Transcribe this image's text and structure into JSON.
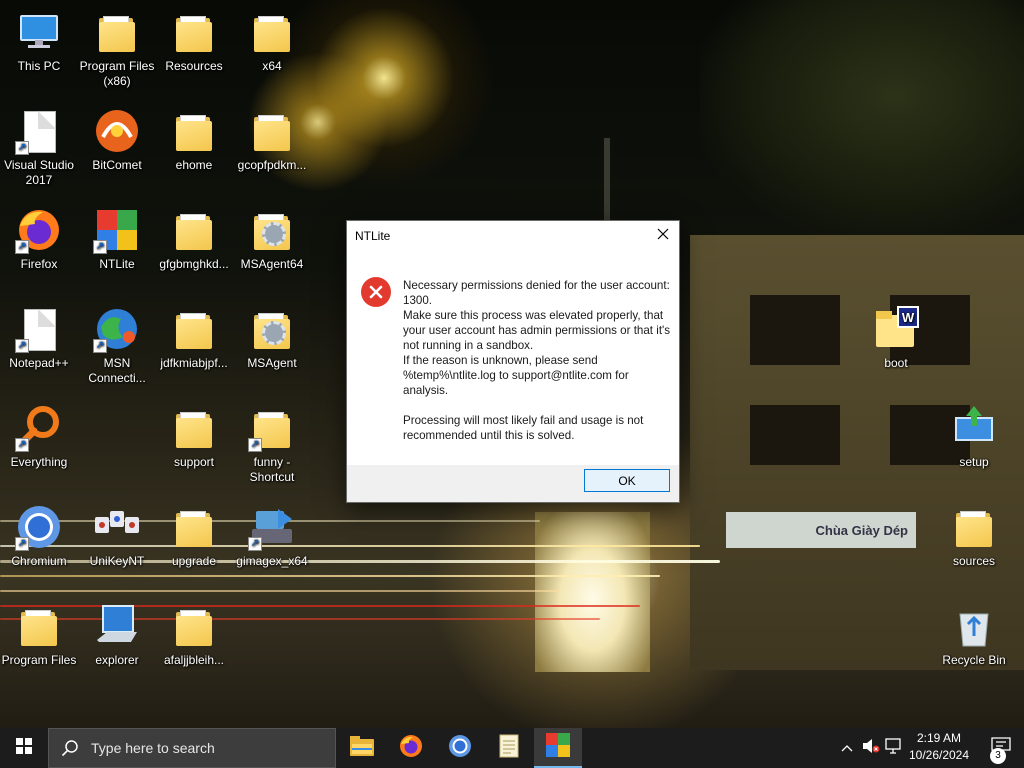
{
  "desktop": {
    "icons": [
      {
        "label": "This PC",
        "kind": "pc"
      },
      {
        "label": "Program Files (x86)",
        "kind": "folder"
      },
      {
        "label": "Resources",
        "kind": "folder"
      },
      {
        "label": "x64",
        "kind": "folder"
      },
      {
        "label": "Visual Studio 2017",
        "kind": "doc-shortcut"
      },
      {
        "label": "BitComet",
        "kind": "bitcomet"
      },
      {
        "label": "ehome",
        "kind": "folder"
      },
      {
        "label": "gcopfpdkm...",
        "kind": "folder"
      },
      {
        "label": "Firefox",
        "kind": "firefox"
      },
      {
        "label": "NTLite",
        "kind": "ntlite"
      },
      {
        "label": "gfgbmghkd...",
        "kind": "folder"
      },
      {
        "label": "MSAgent64",
        "kind": "folder-gear"
      },
      {
        "label": "Notepad++",
        "kind": "doc-shortcut"
      },
      {
        "label": "MSN Connecti...",
        "kind": "msn"
      },
      {
        "label": "jdfkmiabjpf...",
        "kind": "folder"
      },
      {
        "label": "MSAgent",
        "kind": "folder-gear"
      },
      {
        "label": "Everything",
        "kind": "everything"
      },
      {
        "label": "support",
        "kind": "folder"
      },
      {
        "label": "funny - Shortcut",
        "kind": "folder-shortcut"
      },
      {
        "label": "Chromium",
        "kind": "chromium"
      },
      {
        "label": "UniKeyNT",
        "kind": "unikey"
      },
      {
        "label": "upgrade",
        "kind": "folder"
      },
      {
        "label": "gimagex_x64",
        "kind": "gimagex"
      },
      {
        "label": "Program Files",
        "kind": "folder"
      },
      {
        "label": "explorer",
        "kind": "explorer"
      },
      {
        "label": "afaljjbleih...",
        "kind": "folder"
      },
      {
        "label": "boot",
        "kind": "boot"
      },
      {
        "label": "setup",
        "kind": "setup"
      },
      {
        "label": "sources",
        "kind": "folder"
      },
      {
        "label": "Recycle Bin",
        "kind": "recycle"
      }
    ]
  },
  "scene": {
    "shop_sign": "Chùa Giày Dép"
  },
  "dialog": {
    "title": "NTLite",
    "close_glyph": "✕",
    "error_glyph": "✕",
    "lines": [
      "Necessary permissions denied for the user account: 1300.",
      "Make sure this process was elevated properly, that your user account has admin permissions or that it's not running in a sandbox.",
      "If the reason is unknown, please send %temp%\\ntlite.log to support@ntlite.com for analysis."
    ],
    "note": "Processing will most likely fail and usage is not recommended until this is solved.",
    "ok_label": "OK"
  },
  "taskbar": {
    "search_placeholder": "Type here to search",
    "apps": [
      "file-explorer",
      "firefox",
      "chromium",
      "notepad",
      "ntlite"
    ],
    "time": "2:19 AM",
    "date": "10/26/2024",
    "notification_count": "3",
    "colors": {
      "background": "#1c1c1c",
      "accent": "#76b9ed"
    }
  }
}
